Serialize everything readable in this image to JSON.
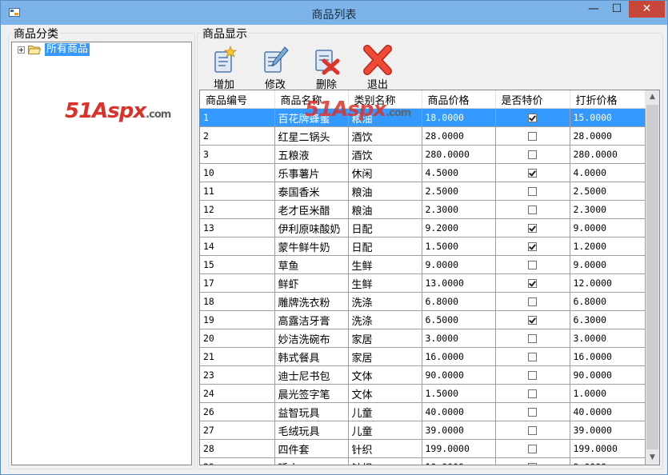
{
  "window": {
    "title": "商品列表",
    "minimize_glyph": "—",
    "maximize_glyph": "☐",
    "close_glyph": "✕"
  },
  "left_panel": {
    "group_label": "商品分类",
    "tree": {
      "root_label": "所有商品"
    }
  },
  "right_panel": {
    "group_label": "商品显示",
    "toolbar": {
      "add_label": "增加",
      "edit_label": "修改",
      "delete_label": "删除",
      "exit_label": "退出"
    }
  },
  "watermark": {
    "main": "51Aspx",
    "suffix": ".com"
  },
  "grid": {
    "columns": [
      "商品编号",
      "商品名称",
      "类别名称",
      "商品价格",
      "是否特价",
      "打折价格"
    ],
    "selected_index": 0,
    "rows": [
      {
        "id": "1",
        "name": "百花牌蜂蜜",
        "category": "粮油",
        "price": "18.0000",
        "special": true,
        "discount": "15.0000"
      },
      {
        "id": "2",
        "name": "红星二锅头",
        "category": "酒饮",
        "price": "28.0000",
        "special": false,
        "discount": "28.0000"
      },
      {
        "id": "3",
        "name": "五粮液",
        "category": "酒饮",
        "price": "280.0000",
        "special": false,
        "discount": "280.0000"
      },
      {
        "id": "10",
        "name": "乐事薯片",
        "category": "休闲",
        "price": "4.5000",
        "special": true,
        "discount": "4.0000"
      },
      {
        "id": "11",
        "name": "泰国香米",
        "category": "粮油",
        "price": "2.5000",
        "special": false,
        "discount": "2.5000"
      },
      {
        "id": "12",
        "name": "老才臣米醋",
        "category": "粮油",
        "price": "2.3000",
        "special": false,
        "discount": "2.3000"
      },
      {
        "id": "13",
        "name": "伊利原味酸奶",
        "category": "日配",
        "price": "9.2000",
        "special": true,
        "discount": "9.0000"
      },
      {
        "id": "14",
        "name": "蒙牛鲜牛奶",
        "category": "日配",
        "price": "1.5000",
        "special": true,
        "discount": "1.2000"
      },
      {
        "id": "15",
        "name": "草鱼",
        "category": "生鲜",
        "price": "9.0000",
        "special": false,
        "discount": "9.0000"
      },
      {
        "id": "17",
        "name": "鲜虾",
        "category": "生鲜",
        "price": "13.0000",
        "special": true,
        "discount": "12.0000"
      },
      {
        "id": "18",
        "name": "雕牌洗衣粉",
        "category": "洗涤",
        "price": "6.8000",
        "special": false,
        "discount": "6.8000"
      },
      {
        "id": "19",
        "name": "高露洁牙膏",
        "category": "洗涤",
        "price": "6.5000",
        "special": true,
        "discount": "6.3000"
      },
      {
        "id": "20",
        "name": "妙洁洗碗布",
        "category": "家居",
        "price": "3.0000",
        "special": false,
        "discount": "3.0000"
      },
      {
        "id": "21",
        "name": "韩式餐具",
        "category": "家居",
        "price": "16.0000",
        "special": false,
        "discount": "16.0000"
      },
      {
        "id": "23",
        "name": "迪士尼书包",
        "category": "文体",
        "price": "90.0000",
        "special": false,
        "discount": "90.0000"
      },
      {
        "id": "24",
        "name": "晨光签字笔",
        "category": "文体",
        "price": "1.5000",
        "special": false,
        "discount": "1.0000"
      },
      {
        "id": "26",
        "name": "益智玩具",
        "category": "儿童",
        "price": "40.0000",
        "special": false,
        "discount": "40.0000"
      },
      {
        "id": "27",
        "name": "毛绒玩具",
        "category": "儿童",
        "price": "39.0000",
        "special": false,
        "discount": "39.0000"
      },
      {
        "id": "28",
        "name": "四件套",
        "category": "针织",
        "price": "199.0000",
        "special": false,
        "discount": "199.0000"
      },
      {
        "id": "29",
        "name": "睡衣",
        "category": "针织",
        "price": "10.0000",
        "special": true,
        "discount": "9.0000"
      }
    ]
  }
}
